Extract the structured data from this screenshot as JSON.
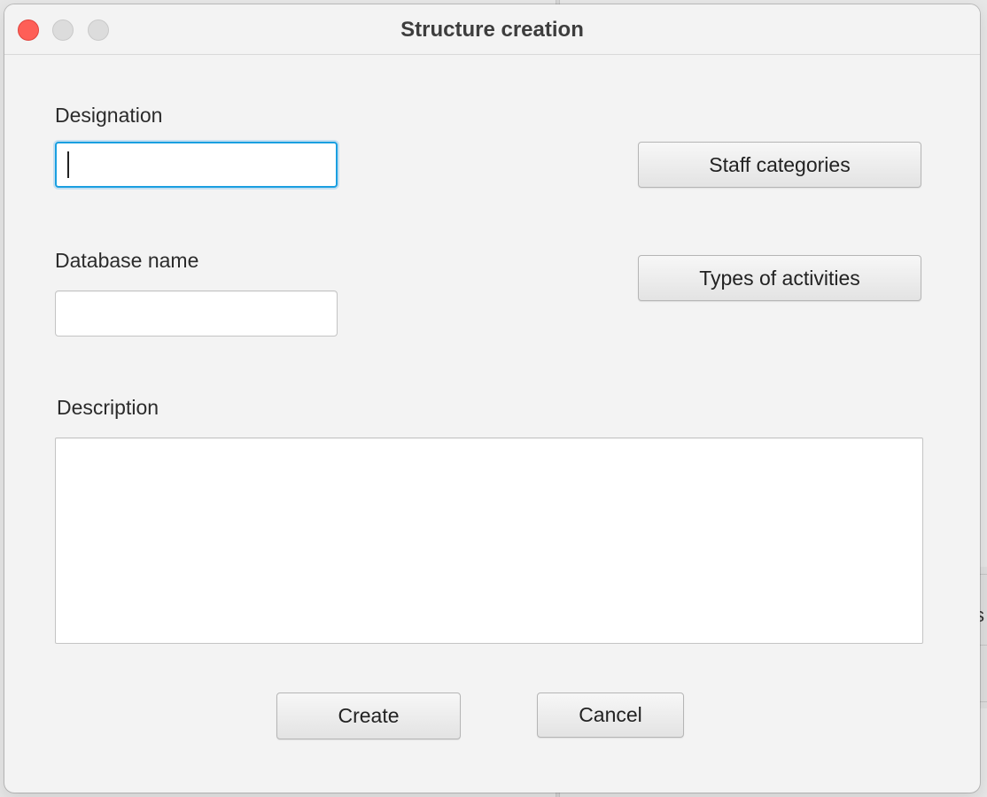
{
  "window": {
    "title": "Structure creation"
  },
  "form": {
    "designation_label": "Designation",
    "designation_value": "",
    "database_label": "Database name",
    "database_value": "",
    "description_label": "Description",
    "description_value": ""
  },
  "buttons": {
    "staff_categories": "Staff categories",
    "types_of_activities": "Types of activities",
    "create": "Create",
    "cancel": "Cancel"
  },
  "background": {
    "partial_glyph": "s"
  },
  "colors": {
    "close_button": "#fe5f57",
    "focus_ring": "#1a9fe0"
  }
}
